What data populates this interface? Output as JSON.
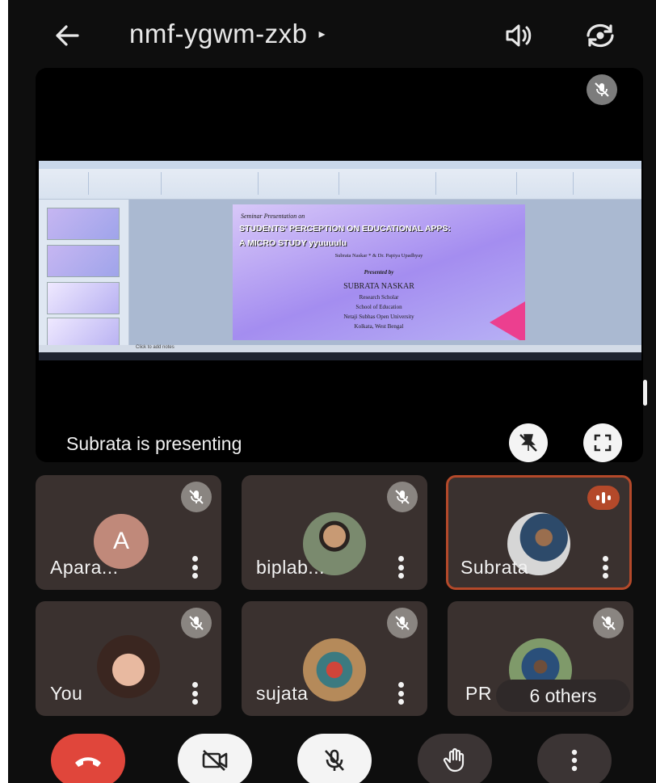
{
  "header": {
    "meeting_code": "nmf-ygwm-zxb",
    "expand_glyph": "▸",
    "icons": [
      "back-arrow-icon",
      "speaker-icon",
      "switch-camera-icon"
    ]
  },
  "presentation": {
    "presenting_text": "Subrata is presenting",
    "slide": {
      "kicker": "Seminar Presentation on",
      "title_line1": "STUDENTS' PERCEPTION ON EDUCATIONAL APPS:",
      "title_line2": "A MICRO STUDY yyuuuulu",
      "authors_line": "Subrata Naskar * & Dr. Papiya Upadhyay",
      "presented_by": "Presented by",
      "presenter": "SUBRATA NASKAR",
      "role": "Research Scholar",
      "school": "School of Education",
      "university": "Netaji Subhas Open University",
      "location": "Kolkata, West Bengal"
    },
    "notes_placeholder": "Click to add notes"
  },
  "participants": [
    {
      "name": "Apara...",
      "avatar_letter": "A",
      "muted": true,
      "speaking": false
    },
    {
      "name": "biplab...",
      "muted": true,
      "speaking": false
    },
    {
      "name": "Subrata",
      "muted": false,
      "speaking": true
    },
    {
      "name": "You",
      "muted": true,
      "speaking": false
    },
    {
      "name": "sujata",
      "muted": true,
      "speaking": false
    },
    {
      "name": "PR",
      "muted": true,
      "speaking": false
    }
  ],
  "others_label": "6 others",
  "controls": [
    "end-call",
    "camera-off",
    "mic-off",
    "raise-hand",
    "more-options"
  ],
  "colors": {
    "background": "#0e0e0e",
    "tile": "#3a312f",
    "active_speaker": "#b4492a",
    "end_call": "#e0463b",
    "control_button": "#f4f4f4"
  }
}
